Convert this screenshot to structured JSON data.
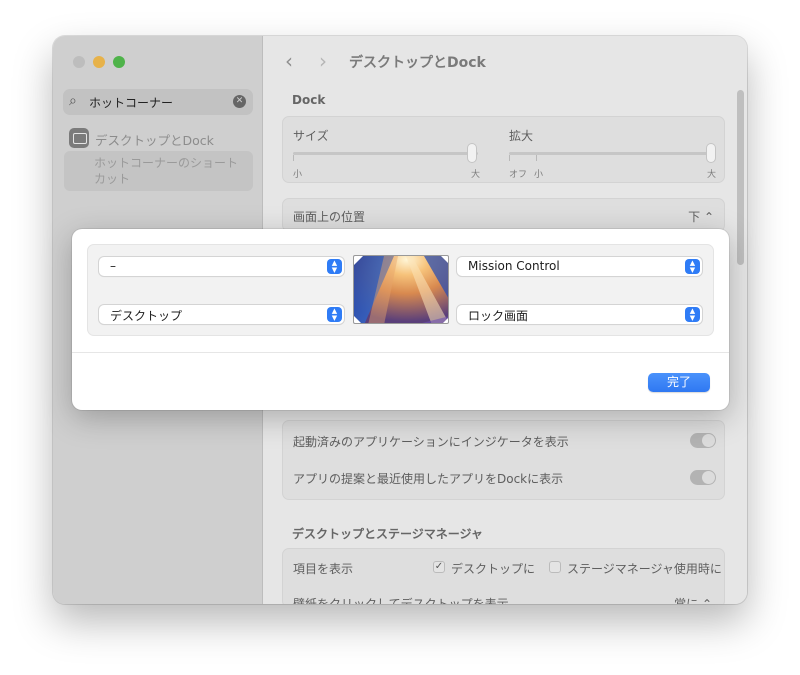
{
  "window": {
    "title": "デスクトップとDock"
  },
  "sidebar": {
    "search_value": "ホットコーナー",
    "item_label": "デスクトップとDock",
    "subitem_label": "ホットコーナーのショートカット"
  },
  "settings": {
    "dock_header": "Dock",
    "size_label": "サイズ",
    "size_small": "小",
    "size_large": "大",
    "size_value": 0.97,
    "magnify_label": "拡大",
    "magnify_off": "オフ",
    "magnify_small": "小",
    "magnify_large": "大",
    "magnify_value": 1.0,
    "position_label": "画面上の位置",
    "position_value": "下",
    "indicator_label": "起動済みのアプリケーションにインジケータを表示",
    "suggest_label": "アプリの提案と最近使用したアプリをDockに表示",
    "stage_header": "デスクトップとステージマネージャ",
    "show_items_label": "項目を表示",
    "show_desktop_label": "デスクトップに",
    "show_desktop_checked": true,
    "show_stage_label": "ステージマネージャ使用時に",
    "show_stage_checked": false,
    "click_wallpaper_label": "壁紙をクリックしてデスクトップを表示",
    "click_wallpaper_value": "常に"
  },
  "hot_corners": {
    "top_left": "–",
    "top_right": "Mission Control",
    "bottom_left": "デスクトップ",
    "bottom_right": "ロック画面",
    "done_label": "完了"
  },
  "colors": {
    "accent": "#2f7cf6",
    "overlay_dim": "#e6e6e6"
  }
}
